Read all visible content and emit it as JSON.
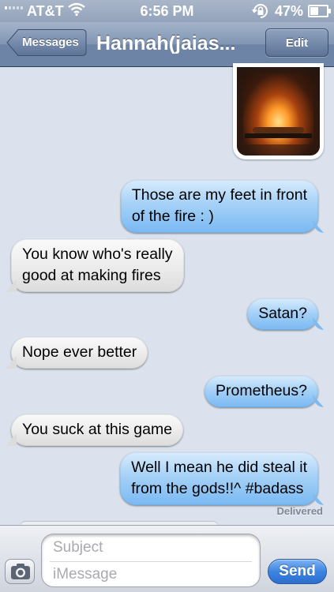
{
  "status_bar": {
    "carrier": "AT&T",
    "time": "6:56 PM",
    "battery_percent": "47%",
    "battery_level": 0.47,
    "signal_icon": "signal-bars-icon",
    "wifi_icon": "wifi-icon",
    "lock_icon": "rotation-lock-icon"
  },
  "nav": {
    "back_label": "Messages",
    "title": "Hannah(jaias...",
    "edit_label": "Edit"
  },
  "conversation": {
    "photo_alt": "fireplace-photo",
    "messages": [
      {
        "direction": "out",
        "lines": [
          "Those are my feet in front",
          "of the fire : )"
        ]
      },
      {
        "direction": "in",
        "lines": [
          "You know who's really",
          "good at making fires"
        ]
      },
      {
        "direction": "out",
        "lines": [
          "Satan?"
        ]
      },
      {
        "direction": "in",
        "lines": [
          "Nope ever better"
        ]
      },
      {
        "direction": "out",
        "lines": [
          "Prometheus?"
        ]
      },
      {
        "direction": "in",
        "lines": [
          "You suck at this game"
        ]
      },
      {
        "direction": "out",
        "lines": [
          "Well I mean he did steal it",
          "from the gods!!^ #badass"
        ]
      }
    ],
    "delivered_label": "Delivered"
  },
  "input_bar": {
    "subject_placeholder": "Subject",
    "message_placeholder": "iMessage",
    "send_label": "Send",
    "camera_icon": "camera-icon"
  },
  "colors": {
    "background": "#dbe2ed",
    "outgoing_bubble": "#79b9f2",
    "incoming_bubble": "#e6e6e6",
    "send_button": "#3d84e0",
    "nav_bar": "#6d84a6"
  }
}
